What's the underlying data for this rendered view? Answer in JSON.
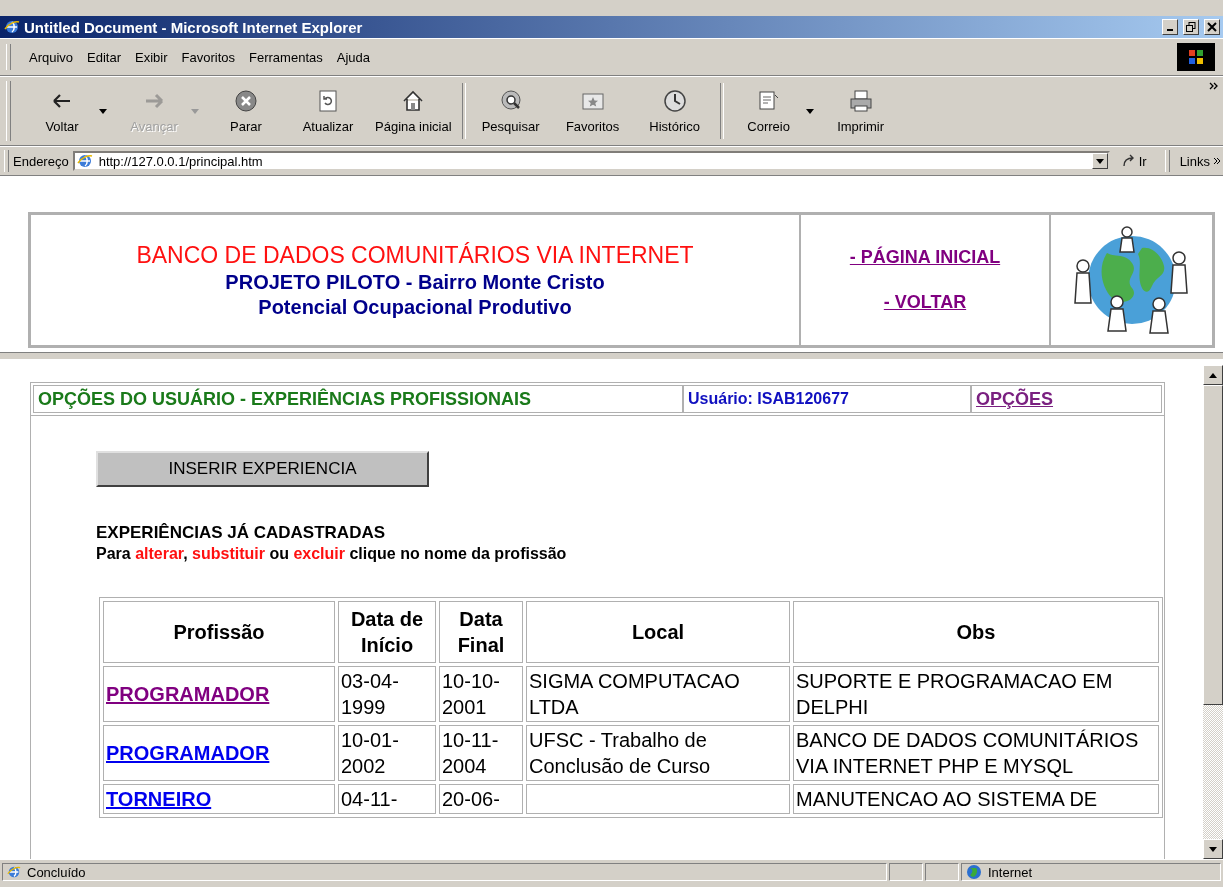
{
  "window": {
    "title": "Untitled Document - Microsoft Internet Explorer"
  },
  "menu": [
    {
      "label": "Arquivo"
    },
    {
      "label": "Editar"
    },
    {
      "label": "Exibir"
    },
    {
      "label": "Favoritos"
    },
    {
      "label": "Ferramentas"
    },
    {
      "label": "Ajuda"
    }
  ],
  "toolbar": [
    {
      "kind": "back",
      "label": "Voltar",
      "disabled": false,
      "dropdown": true
    },
    {
      "kind": "forward",
      "label": "Avançar",
      "disabled": true,
      "dropdown": true
    },
    {
      "kind": "stop",
      "label": "Parar",
      "disabled": false,
      "dropdown": false
    },
    {
      "kind": "refresh",
      "label": "Atualizar",
      "disabled": false,
      "dropdown": false
    },
    {
      "kind": "home",
      "label": "Página inicial",
      "disabled": false,
      "dropdown": false
    },
    {
      "kind": "separator"
    },
    {
      "kind": "search",
      "label": "Pesquisar",
      "disabled": false,
      "dropdown": false
    },
    {
      "kind": "favorites",
      "label": "Favoritos",
      "disabled": false,
      "dropdown": false
    },
    {
      "kind": "history",
      "label": "Histórico",
      "disabled": false,
      "dropdown": false
    },
    {
      "kind": "separator"
    },
    {
      "kind": "mail",
      "label": "Correio",
      "disabled": false,
      "dropdown": true
    },
    {
      "kind": "print",
      "label": "Imprimir",
      "disabled": false,
      "dropdown": false
    }
  ],
  "address": {
    "label": "Endereço",
    "value": "http://127.0.0.1/principal.htm",
    "go": "Ir",
    "links": "Links"
  },
  "header": {
    "title": "BANCO DE DADOS COMUNITÁRIOS VIA INTERNET",
    "subtitle": "PROJETO PILOTO - Bairro Monte Cristo",
    "subtitle2": "Potencial Ocupacional Produtivo",
    "links": [
      {
        "label": "- PÁGINA INICIAL",
        "visited": true
      },
      {
        "label": "- VOLTAR",
        "visited": true
      }
    ]
  },
  "section_bar": {
    "title": "OPÇÕES DO USUÁRIO - EXPERIÊNCIAS PROFISSIONAIS",
    "user": "Usuário: ISAB120677",
    "options_link": "OPÇÕES"
  },
  "insert_button": "INSERIR EXPERIENCIA",
  "list_heading": "EXPERIÊNCIAS JÁ CADASTRADAS",
  "instructions": [
    {
      "text": "Para ",
      "highlight": false
    },
    {
      "text": "alterar",
      "highlight": true
    },
    {
      "text": ", ",
      "highlight": false
    },
    {
      "text": "substituir",
      "highlight": true
    },
    {
      "text": " ou ",
      "highlight": false
    },
    {
      "text": "excluir",
      "highlight": true
    },
    {
      "text": " clique no nome da profissão",
      "highlight": false
    }
  ],
  "table": {
    "columns": [
      "Profissão",
      "Data de Início",
      "Data Final",
      "Local",
      "Obs"
    ],
    "rows": [
      {
        "profession": "PROGRAMADOR",
        "visited": true,
        "start": "03-04-1999",
        "end": "10-10-2001",
        "local": "SIGMA COMPUTACAO LTDA",
        "obs": "SUPORTE E PROGRAMACAO EM DELPHI"
      },
      {
        "profession": "PROGRAMADOR",
        "visited": false,
        "start": "10-01-2002",
        "end": "10-11-2004",
        "local": "UFSC - Trabalho de Conclusão de Curso",
        "obs": "BANCO DE DADOS COMUNITÁRIOS VIA INTERNET PHP E MYSQL"
      },
      {
        "profession": "TORNEIRO",
        "visited": false,
        "start": "04-11-",
        "end": "20-06-",
        "local": "",
        "obs": "MANUTENCAO AO SISTEMA DE"
      }
    ]
  },
  "status_bar": {
    "text": "Concluído",
    "zone": "Internet"
  }
}
